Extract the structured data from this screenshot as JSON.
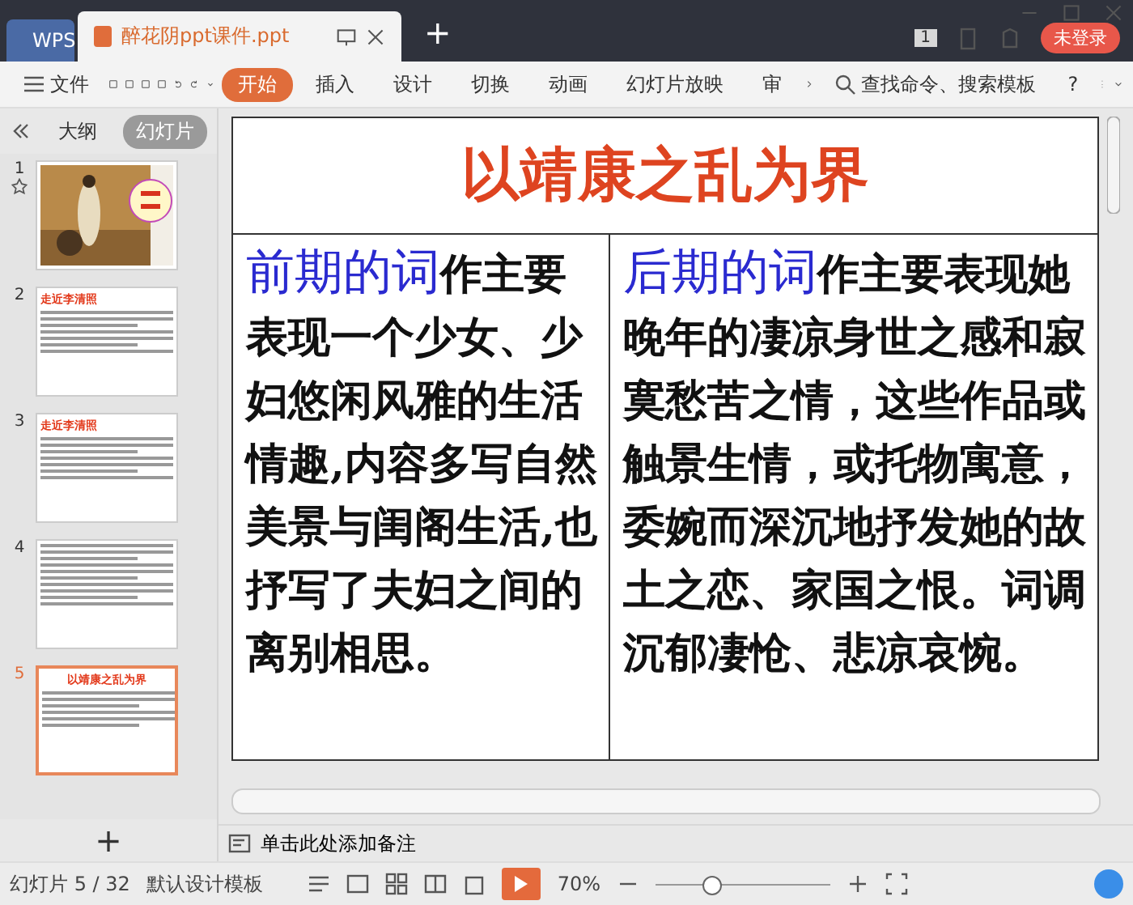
{
  "tabs": [
    {
      "kind": "home",
      "label": "WPS",
      "selected": false
    },
    {
      "kind": "doc",
      "label": "醉花阴ppt课件.ppt",
      "selected": true
    }
  ],
  "new_tab": "+",
  "page_badge": "1",
  "login": "未登录",
  "menu": {
    "file": "文件",
    "ribbon": [
      {
        "label": "开始",
        "selected": true
      },
      {
        "label": "插入",
        "selected": false
      },
      {
        "label": "设计",
        "selected": false
      },
      {
        "label": "切换",
        "selected": false
      },
      {
        "label": "动画",
        "selected": false
      },
      {
        "label": "幻灯片放映",
        "selected": false
      },
      {
        "label": "审",
        "selected": false
      }
    ],
    "search": "查找命令、搜索模板",
    "help": "?"
  },
  "panel": {
    "views": [
      {
        "label": "大纲",
        "selected": false
      },
      {
        "label": "幻灯片",
        "selected": true
      }
    ],
    "thumbnails": [
      {
        "number": "1",
        "kind": "picture",
        "selected": false,
        "starred": true
      },
      {
        "number": "2",
        "kind": "text",
        "title": "走近李清照",
        "selected": false,
        "starred": false
      },
      {
        "number": "3",
        "kind": "text",
        "title": "走近李清照",
        "selected": false,
        "starred": false
      },
      {
        "number": "4",
        "kind": "text",
        "selected": false,
        "starred": false
      },
      {
        "number": "5",
        "kind": "table",
        "title": "以靖康之乱为界",
        "selected": true,
        "starred": false
      }
    ],
    "add": "+"
  },
  "slide": {
    "title": "以靖康之乱为界",
    "columns": [
      {
        "lead": "前期的词",
        "body": "作主要表现一个少女、少妇悠闲风雅的生活情趣,内容多写自然美景与闺阁生活,也抒写了夫妇之间的离别相思。"
      },
      {
        "lead": "后期的词",
        "body": "作主要表现她晚年的凄凉身世之感和寂寞愁苦之情，这些作品或触景生情，或托物寓意，委婉而深沉地抒发她的故土之恋、家国之恨。词调沉郁凄怆、悲凉哀惋。"
      }
    ]
  },
  "notes": "单击此处添加备注",
  "status": {
    "slide": "幻灯片 5 / 32",
    "template": "默认设计模板",
    "zoom": "70%",
    "zoom_slider": {
      "level": 0.32
    }
  }
}
